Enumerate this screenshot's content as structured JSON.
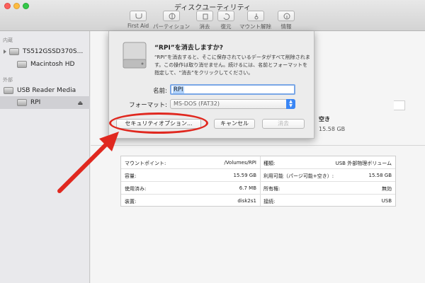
{
  "window": {
    "title": "ディスクユーティリティ"
  },
  "toolbar": {
    "first_aid": "First Aid",
    "partition": "パーティション",
    "erase": "消去",
    "restore": "復元",
    "unmount": "マウント解除",
    "info": "情報"
  },
  "sidebar": {
    "internal_header": "内蔵",
    "external_header": "外部",
    "internal_disk": "TS512GSSD370S...",
    "internal_volume": "Macintosh HD",
    "external_disk": "USB Reader Media",
    "external_volume": "RPI"
  },
  "volume": {
    "available_label": "空き",
    "available_value": "15.58 GB"
  },
  "info_table": {
    "rows": [
      {
        "k1": "マウントポイント:",
        "v1": "/Volumes/RPI",
        "k2": "種類:",
        "v2": "USB 外部物理ボリューム"
      },
      {
        "k1": "容量:",
        "v1": "15.59 GB",
        "k2": "利用可能（パージ可能+空き）:",
        "v2": "15.58 GB"
      },
      {
        "k1": "使用済み:",
        "v1": "6.7 MB",
        "k2": "所有権:",
        "v2": "無効"
      },
      {
        "k1": "装置:",
        "v1": "disk2s1",
        "k2": "接続:",
        "v2": "USB"
      }
    ]
  },
  "sheet": {
    "title": "“RPI”を消去しますか?",
    "body": "“RPI”を消去すると、そこに保存されているデータがすべて削除されます。この操作は取り消せません。続けるには、名前とフォーマットを指定して、“消去”をクリックしてください。",
    "name_label": "名前:",
    "name_value": "RPI",
    "format_label": "フォーマット:",
    "format_value": "MS-DOS (FAT32)",
    "security_button": "セキュリティオプション...",
    "cancel_button": "キャンセル",
    "erase_button": "消去"
  },
  "colors": {
    "annotation": "#e0281f",
    "select_accent": "#3a86f5"
  }
}
